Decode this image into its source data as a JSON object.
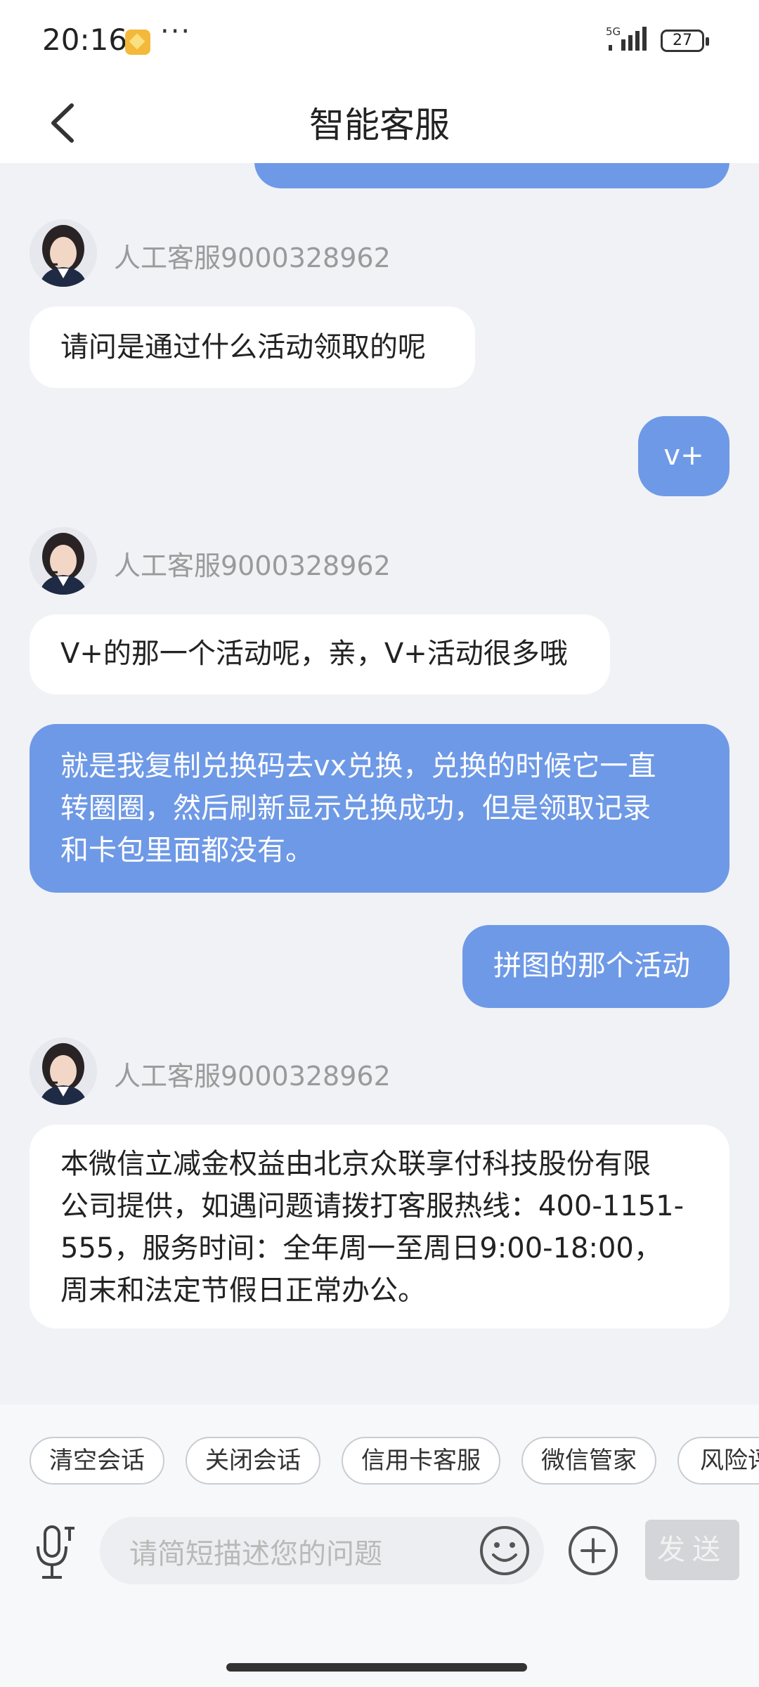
{
  "status_bar": {
    "time": "20:16",
    "more": "···",
    "network": "5G",
    "battery": "27"
  },
  "header": {
    "title": "智能客服"
  },
  "chat": {
    "messages": [
      {
        "type": "agent-name",
        "text": "人工客服9000328962"
      },
      {
        "type": "agent",
        "text": "请问是通过什么活动领取的呢"
      },
      {
        "type": "user",
        "text": "v+"
      },
      {
        "type": "agent-name",
        "text": "人工客服9000328962"
      },
      {
        "type": "agent",
        "text": "V+的那一个活动呢，亲，V+活动很多哦"
      },
      {
        "type": "user",
        "lines": [
          "就是我复制兑换码去vx兑换，兑换的时候它一直",
          "转圈圈，然后刷新显示兑换成功，但是领取记录",
          "和卡包里面都没有。"
        ]
      },
      {
        "type": "user",
        "text": "拼图的那个活动"
      },
      {
        "type": "agent-name",
        "text": "人工客服9000328962"
      },
      {
        "type": "agent",
        "lines": [
          "本微信立减金权益由北京众联享付科技股份有限",
          "公司提供，如遇问题请拨打客服热线：400-1151-",
          "555，服务时间：全年周一至周日9:00-18:00，",
          "周末和法定节假日正常办公。"
        ]
      }
    ]
  },
  "quick_actions": [
    "清空会话",
    "关闭会话",
    "信用卡客服",
    "微信管家",
    "风险评"
  ],
  "input": {
    "placeholder": "请简短描述您的问题"
  },
  "send_label": "发送",
  "icons": {
    "back": "chevron-left-icon",
    "mic": "microphone-icon",
    "emoji": "smile-icon",
    "add": "plus-icon",
    "avatar": "agent-avatar"
  },
  "colors": {
    "user_bubble": "#6e99e6",
    "agent_bubble": "#ffffff",
    "background": "#f1f2f6"
  }
}
